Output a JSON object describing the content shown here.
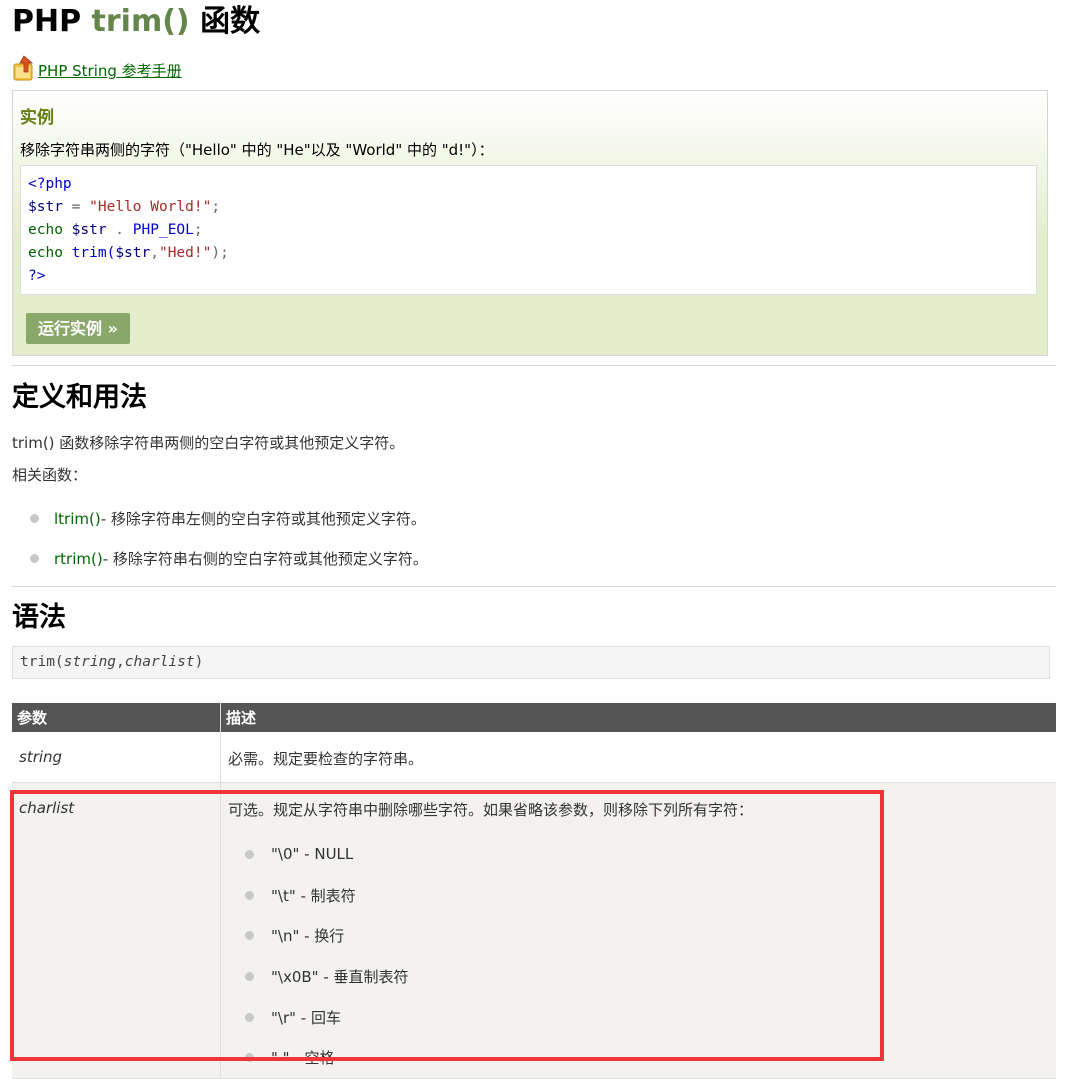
{
  "title": {
    "prefix": "PHP",
    "func": "trim()",
    "suffix": "函数"
  },
  "ref_link": "PHP String 参考手册",
  "example": {
    "heading": "实例",
    "description": "移除字符串两侧的字符（\"Hello\" 中的 \"He\"以及 \"World\" 中的 \"d!\"）：",
    "code": {
      "line1": "<?php",
      "line2_var": "$str",
      "line2_op": " = ",
      "line2_str": "\"Hello World!\"",
      "line2_end": ";",
      "line3_echo": "echo ",
      "line3_var": "$str",
      "line3_op": " . ",
      "line3_const": "PHP_EOL",
      "line3_end": ";",
      "line4_echo": "echo ",
      "line4_fn": "trim(",
      "line4_var": "$str",
      "line4_comma": ",",
      "line4_str": "\"Hed!\"",
      "line4_end": ");",
      "line5": "?>"
    },
    "run_button": "运行实例 »"
  },
  "definition": {
    "heading": "定义和用法",
    "text": "trim() 函数移除字符串两侧的空白字符或其他预定义字符。",
    "related_label": "相关函数：",
    "related": [
      {
        "fn": "ltrim()",
        "desc": " - 移除字符串左侧的空白字符或其他预定义字符。"
      },
      {
        "fn": "rtrim()",
        "desc": " - 移除字符串右侧的空白字符或其他预定义字符。"
      }
    ]
  },
  "syntax": {
    "heading": "语法",
    "fn": "trim(",
    "arg1": "string",
    "comma": ",",
    "arg2": "charlist",
    "close": ")"
  },
  "params_table": {
    "headers": [
      "参数",
      "描述"
    ],
    "rows": [
      {
        "name": "string",
        "desc": "必需。规定要检查的字符串。"
      },
      {
        "name": "charlist",
        "desc": "可选。规定从字符串中删除哪些字符。如果省略该参数，则移除下列所有字符："
      }
    ],
    "charlist_items": [
      "\"\\0\" - NULL",
      "\"\\t\" - 制表符",
      "\"\\n\" - 换行",
      "\"\\x0B\" - 垂直制表符",
      "\"\\r\" - 回车",
      "\" \" - 空格"
    ]
  },
  "colors": {
    "accent_green": "#64854c",
    "link_green": "#006600",
    "button_green": "#8aa86a",
    "header_gray": "#555555",
    "highlight_red": "#f2333a"
  }
}
